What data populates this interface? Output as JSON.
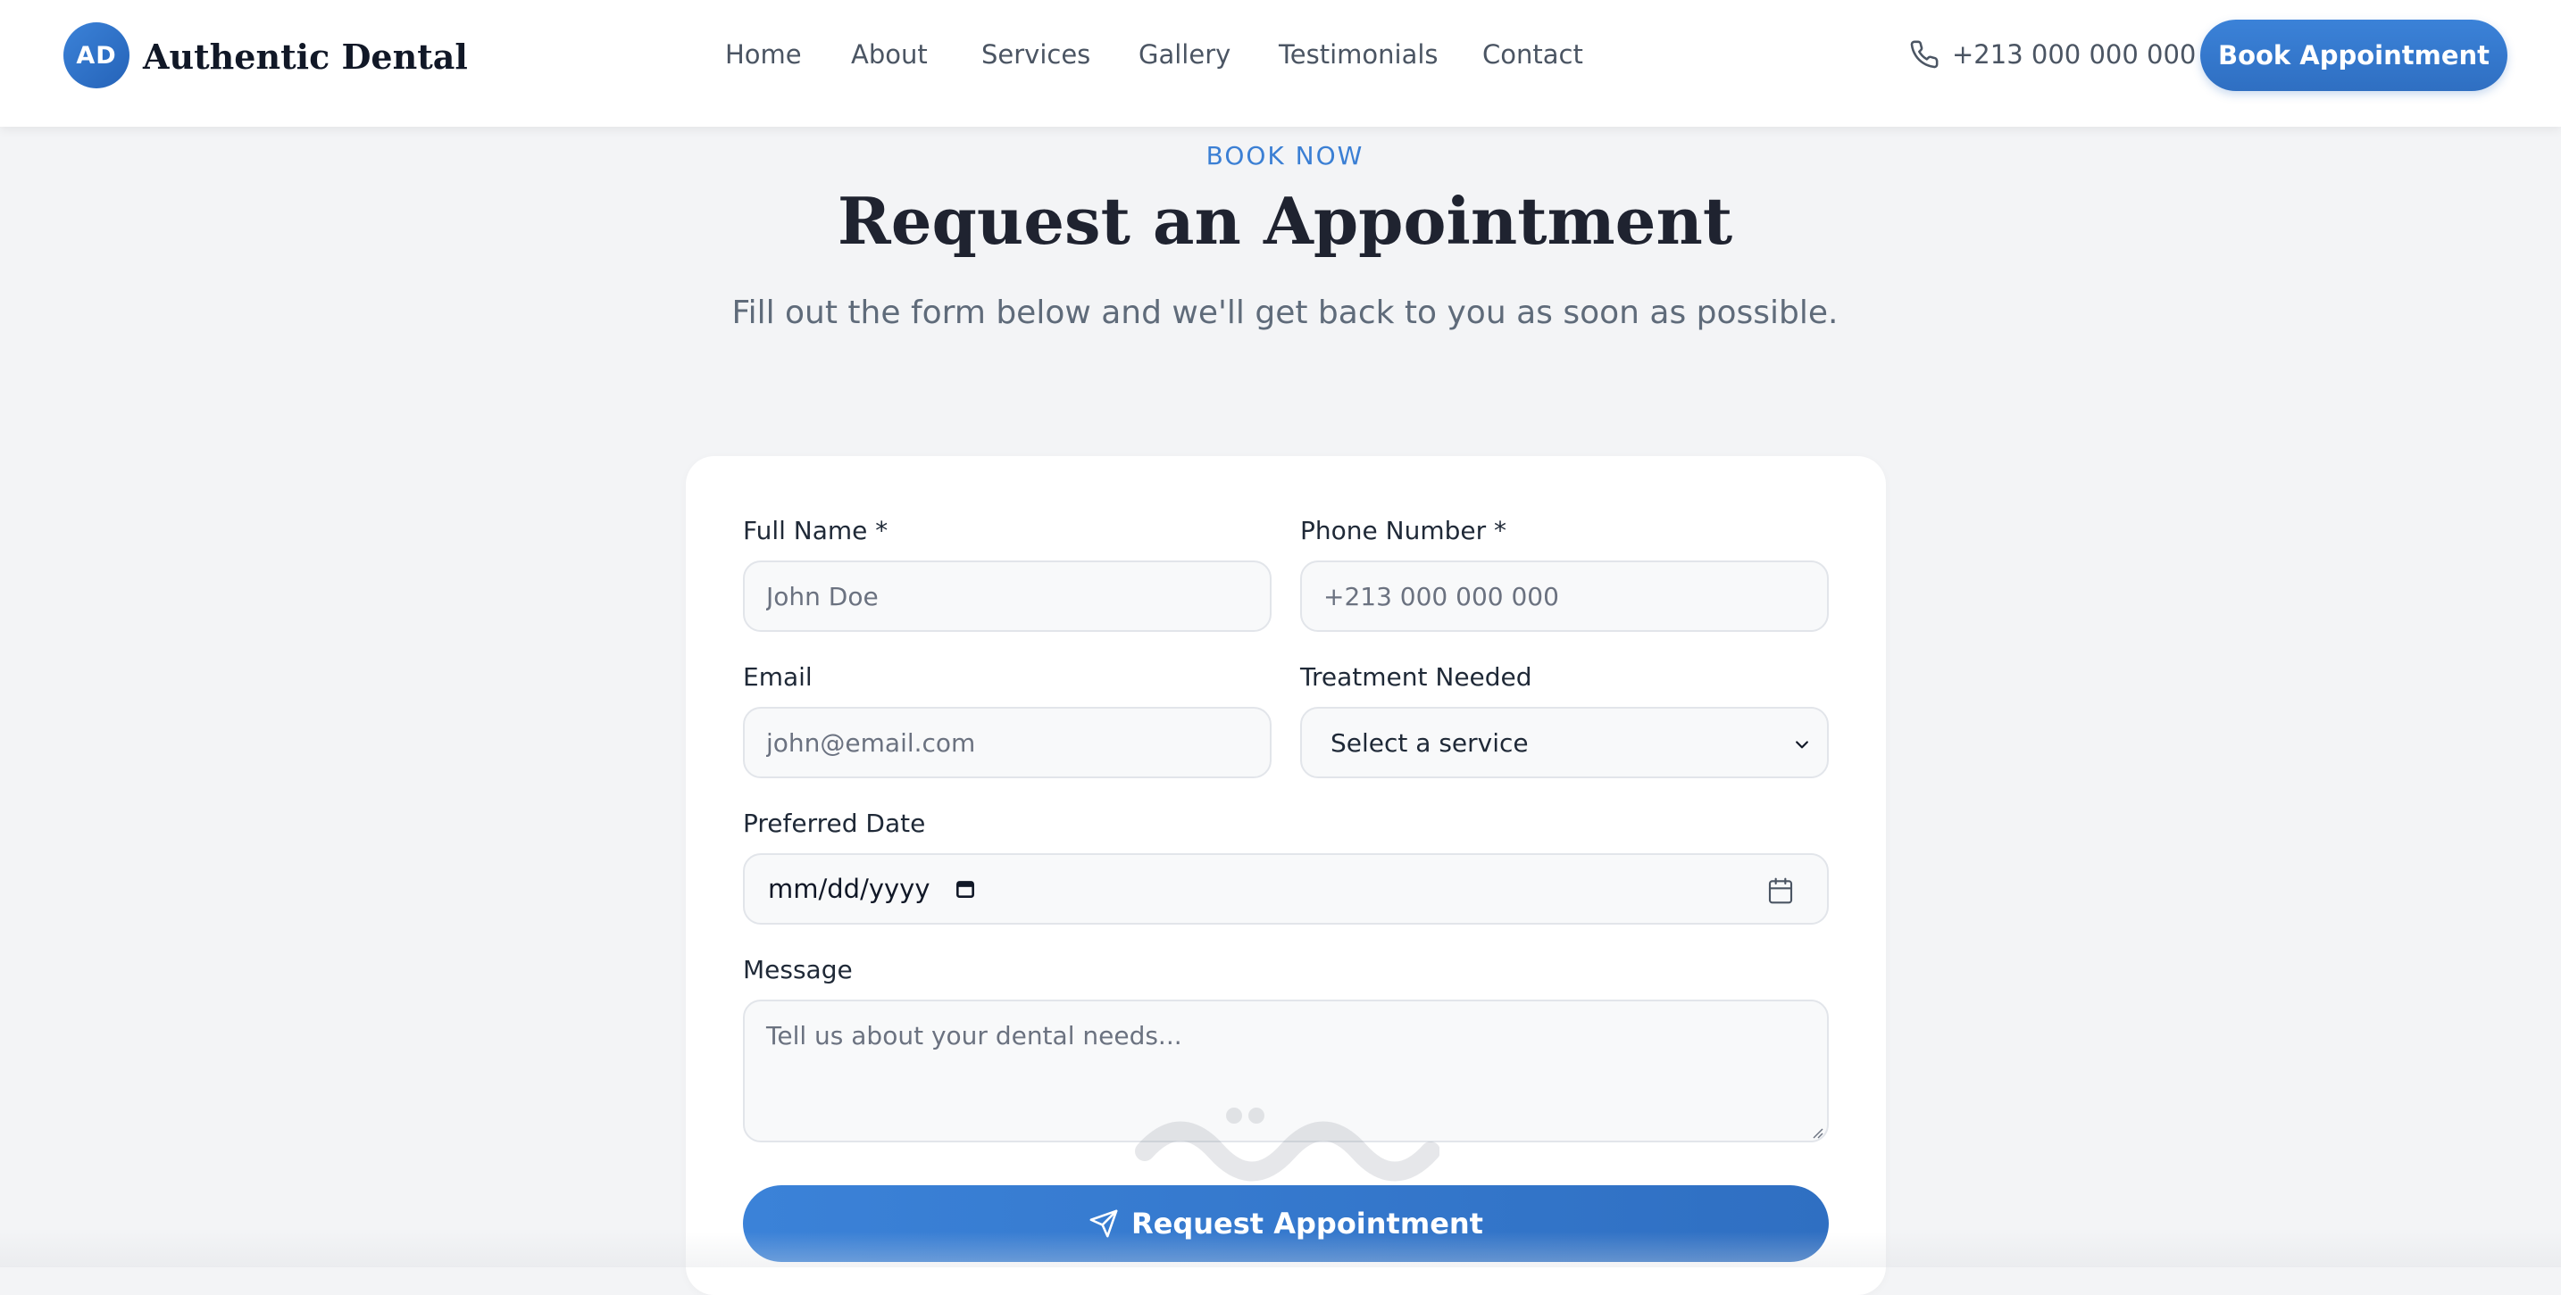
{
  "brand": {
    "initials": "AD",
    "name": "Authentic Dental",
    "accent_color": "#3b82d8"
  },
  "nav": {
    "items": [
      {
        "label": "Home"
      },
      {
        "label": "About"
      },
      {
        "label": "Services"
      },
      {
        "label": "Gallery"
      },
      {
        "label": "Testimonials"
      },
      {
        "label": "Contact"
      }
    ],
    "phone": "+213 000 000 000",
    "phone_icon": "phone-icon",
    "cta_label": "Book Appointment"
  },
  "hero": {
    "eyebrow": "BOOK NOW",
    "title": "Request an Appointment",
    "subtitle": "Fill out the form below and we'll get back to you as soon as possible."
  },
  "form": {
    "full_name": {
      "label": "Full Name *",
      "placeholder": "John Doe",
      "value": ""
    },
    "phone": {
      "label": "Phone Number *",
      "placeholder": "+213 000 000 000",
      "value": ""
    },
    "email": {
      "label": "Email",
      "placeholder": "john@email.com",
      "value": ""
    },
    "treatment": {
      "label": "Treatment Needed",
      "selected": "Select a service"
    },
    "date": {
      "label": "Preferred Date",
      "placeholder": "mm/dd/yyyy",
      "icon": "calendar-icon"
    },
    "message": {
      "label": "Message",
      "placeholder": "Tell us about your dental needs..."
    },
    "submit_label": "Request Appointment",
    "submit_icon": "send-icon"
  }
}
